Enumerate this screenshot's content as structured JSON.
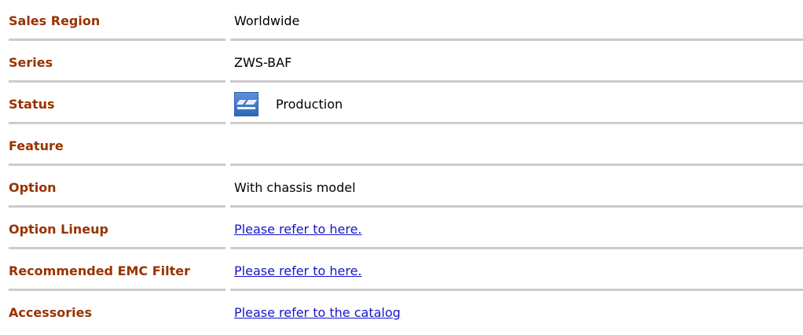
{
  "rows": [
    {
      "label": "Sales Region",
      "value": "Worldwide"
    },
    {
      "label": "Series",
      "value": "ZWS-BAF"
    },
    {
      "label": "Status",
      "value": "Production",
      "icon": "status-production-icon"
    },
    {
      "label": "Feature",
      "value": ""
    },
    {
      "label": "Option",
      "value": "With chassis model"
    },
    {
      "label": "Option Lineup",
      "link": "Please refer to here."
    },
    {
      "label": "Recommended EMC Filter",
      "link": "Please refer to here."
    },
    {
      "label": "Accessories",
      "link": "Please refer to the catalog"
    }
  ],
  "colors": {
    "label": "#993300",
    "link": "#1515cc",
    "divider": "#cccccc"
  }
}
